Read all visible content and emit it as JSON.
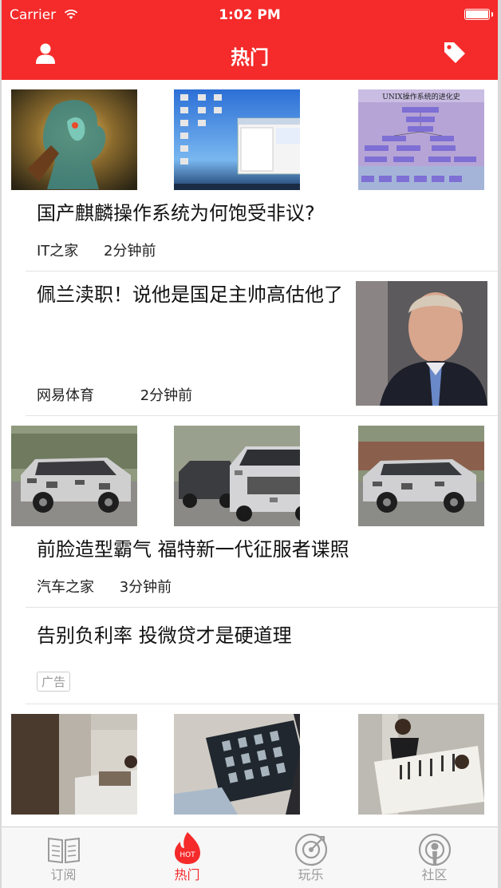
{
  "status_bar": {
    "carrier": "Carrier",
    "time": "1:02 PM"
  },
  "nav": {
    "title": "热门",
    "left_icon": "user-icon",
    "right_icon": "tag-icon"
  },
  "feed": [
    {
      "type": "three-image",
      "title": "国产麒麟操作系统为何饱受非议?",
      "source": "IT之家",
      "time": "2分钟前",
      "images": [
        "fantasy-dragon-art",
        "desktop-screenshot",
        "unix-evolution-diagram"
      ],
      "image_text": "UNIX操作系统的进化史"
    },
    {
      "type": "single-image",
      "title": "佩兰渎职！说他是国足主帅高估他了",
      "source": "网易体育",
      "time": "2分钟前",
      "images": [
        "man-portrait"
      ]
    },
    {
      "type": "three-image",
      "title": "前脸造型霸气 福特新一代征服者谍照",
      "source": "汽车之家",
      "time": "3分钟前",
      "images": [
        "camouflaged-suv-side",
        "camouflaged-suv-front",
        "camouflaged-suv-side-2"
      ]
    },
    {
      "type": "ad",
      "title": "告别负利率 投微贷才是硬道理",
      "badge": "广告"
    },
    {
      "type": "three-image",
      "images": [
        "hospital-room",
        "xray-films",
        "calligraphy-patient"
      ]
    }
  ],
  "tabs": [
    {
      "label": "订阅",
      "icon": "book-icon",
      "active": false
    },
    {
      "label": "热门",
      "icon": "hot-flame-icon",
      "badge": "HOT",
      "active": true
    },
    {
      "label": "玩乐",
      "icon": "target-icon",
      "active": false
    },
    {
      "label": "社区",
      "icon": "broadcast-icon",
      "active": false
    }
  ],
  "colors": {
    "brand_red": "#f52a2a",
    "tab_inactive": "#9a9a9a"
  }
}
